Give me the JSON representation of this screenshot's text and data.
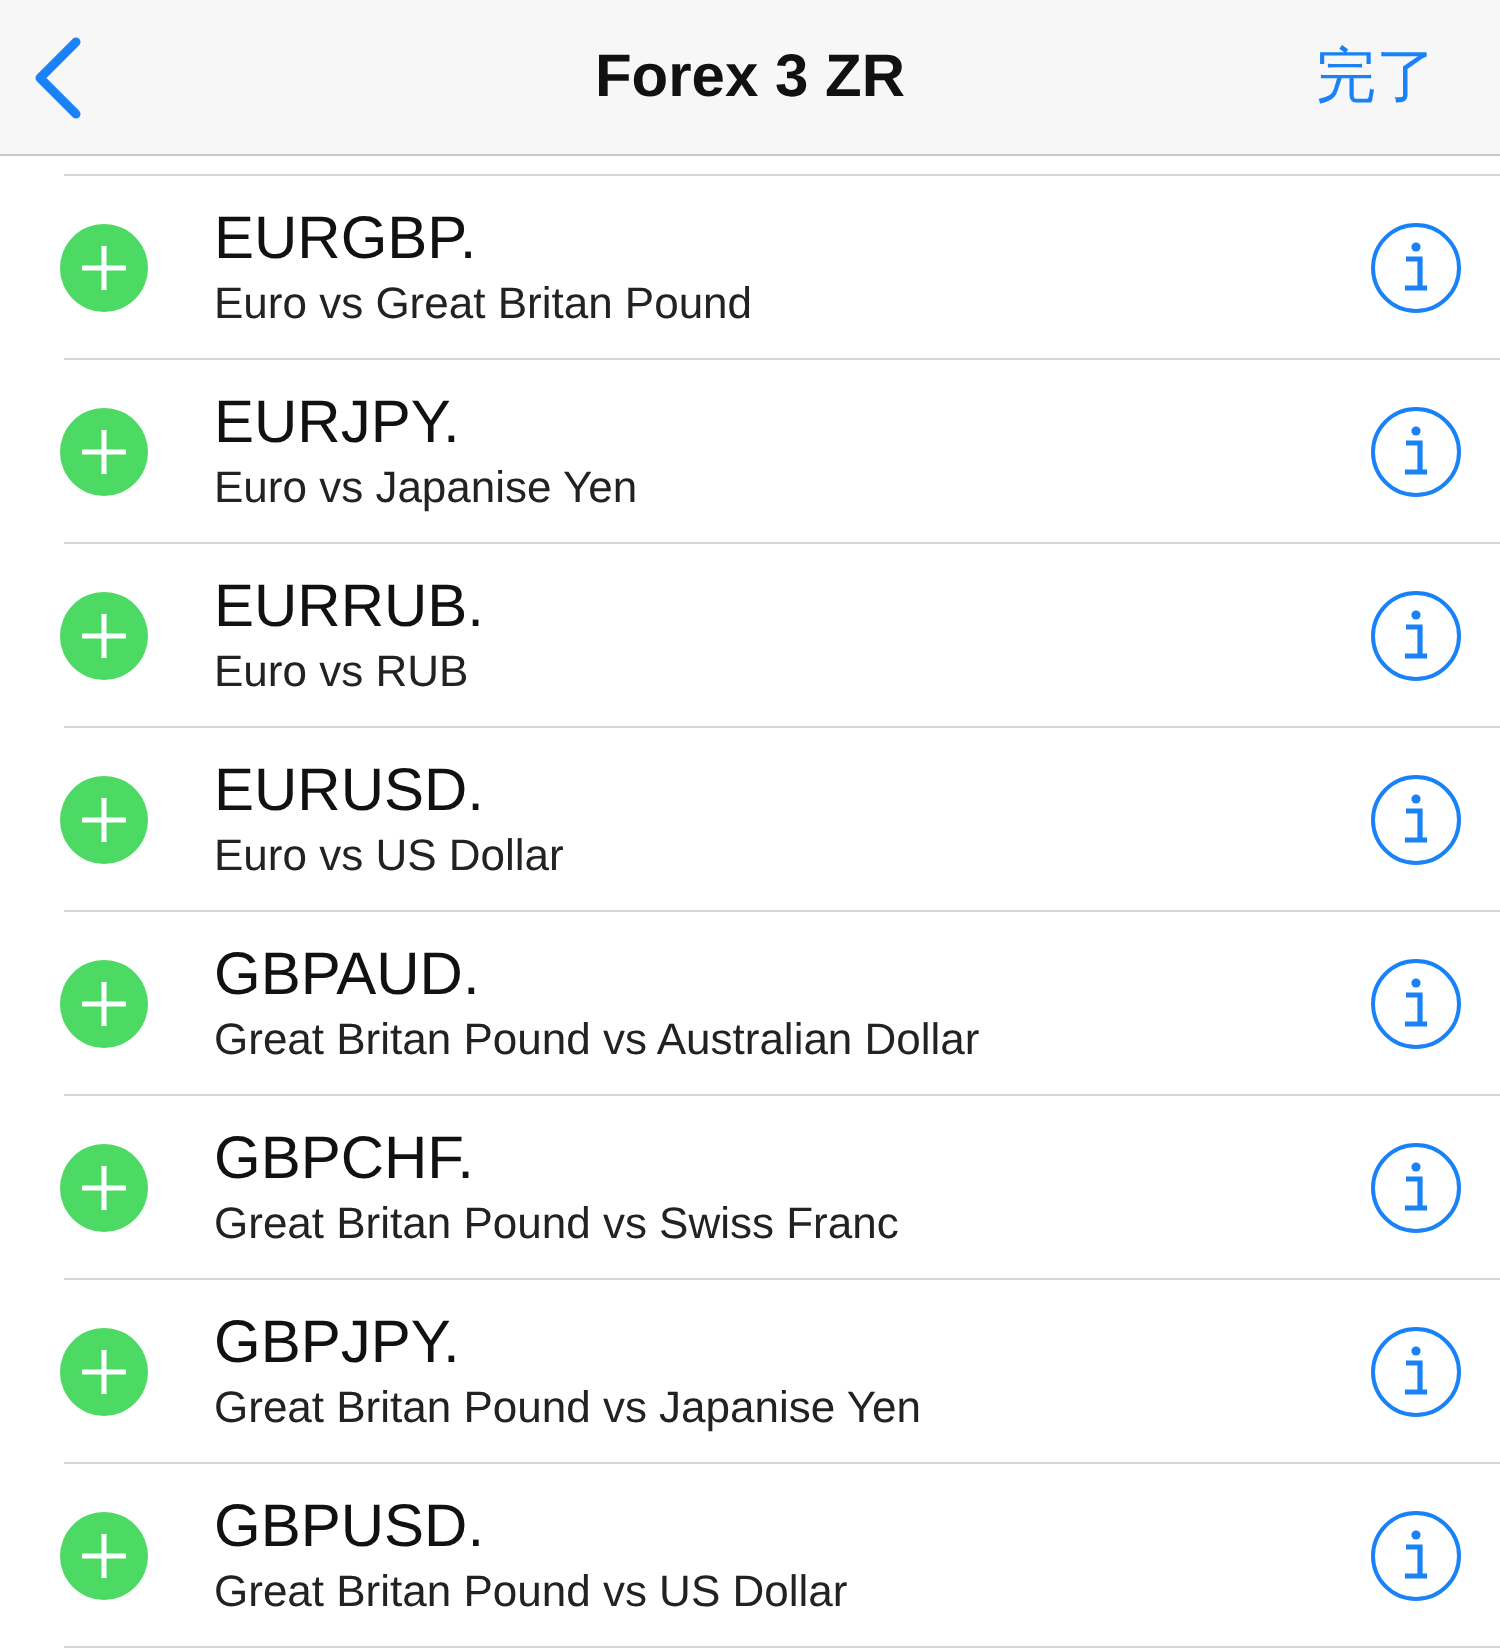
{
  "nav": {
    "title": "Forex 3 ZR",
    "done": "完了"
  },
  "rows": [
    {
      "symbol": "EURGBP.",
      "description": "Euro vs Great Britan Pound"
    },
    {
      "symbol": "EURJPY.",
      "description": "Euro vs Japanise Yen"
    },
    {
      "symbol": "EURRUB.",
      "description": "Euro vs RUB"
    },
    {
      "symbol": "EURUSD.",
      "description": "Euro vs US Dollar"
    },
    {
      "symbol": "GBPAUD.",
      "description": "Great Britan Pound vs Australian Dollar"
    },
    {
      "symbol": "GBPCHF.",
      "description": "Great Britan Pound vs Swiss Franc"
    },
    {
      "symbol": "GBPJPY.",
      "description": "Great Britan Pound vs Japanise Yen"
    },
    {
      "symbol": "GBPUSD.",
      "description": "Great Britan Pound vs US Dollar"
    }
  ]
}
